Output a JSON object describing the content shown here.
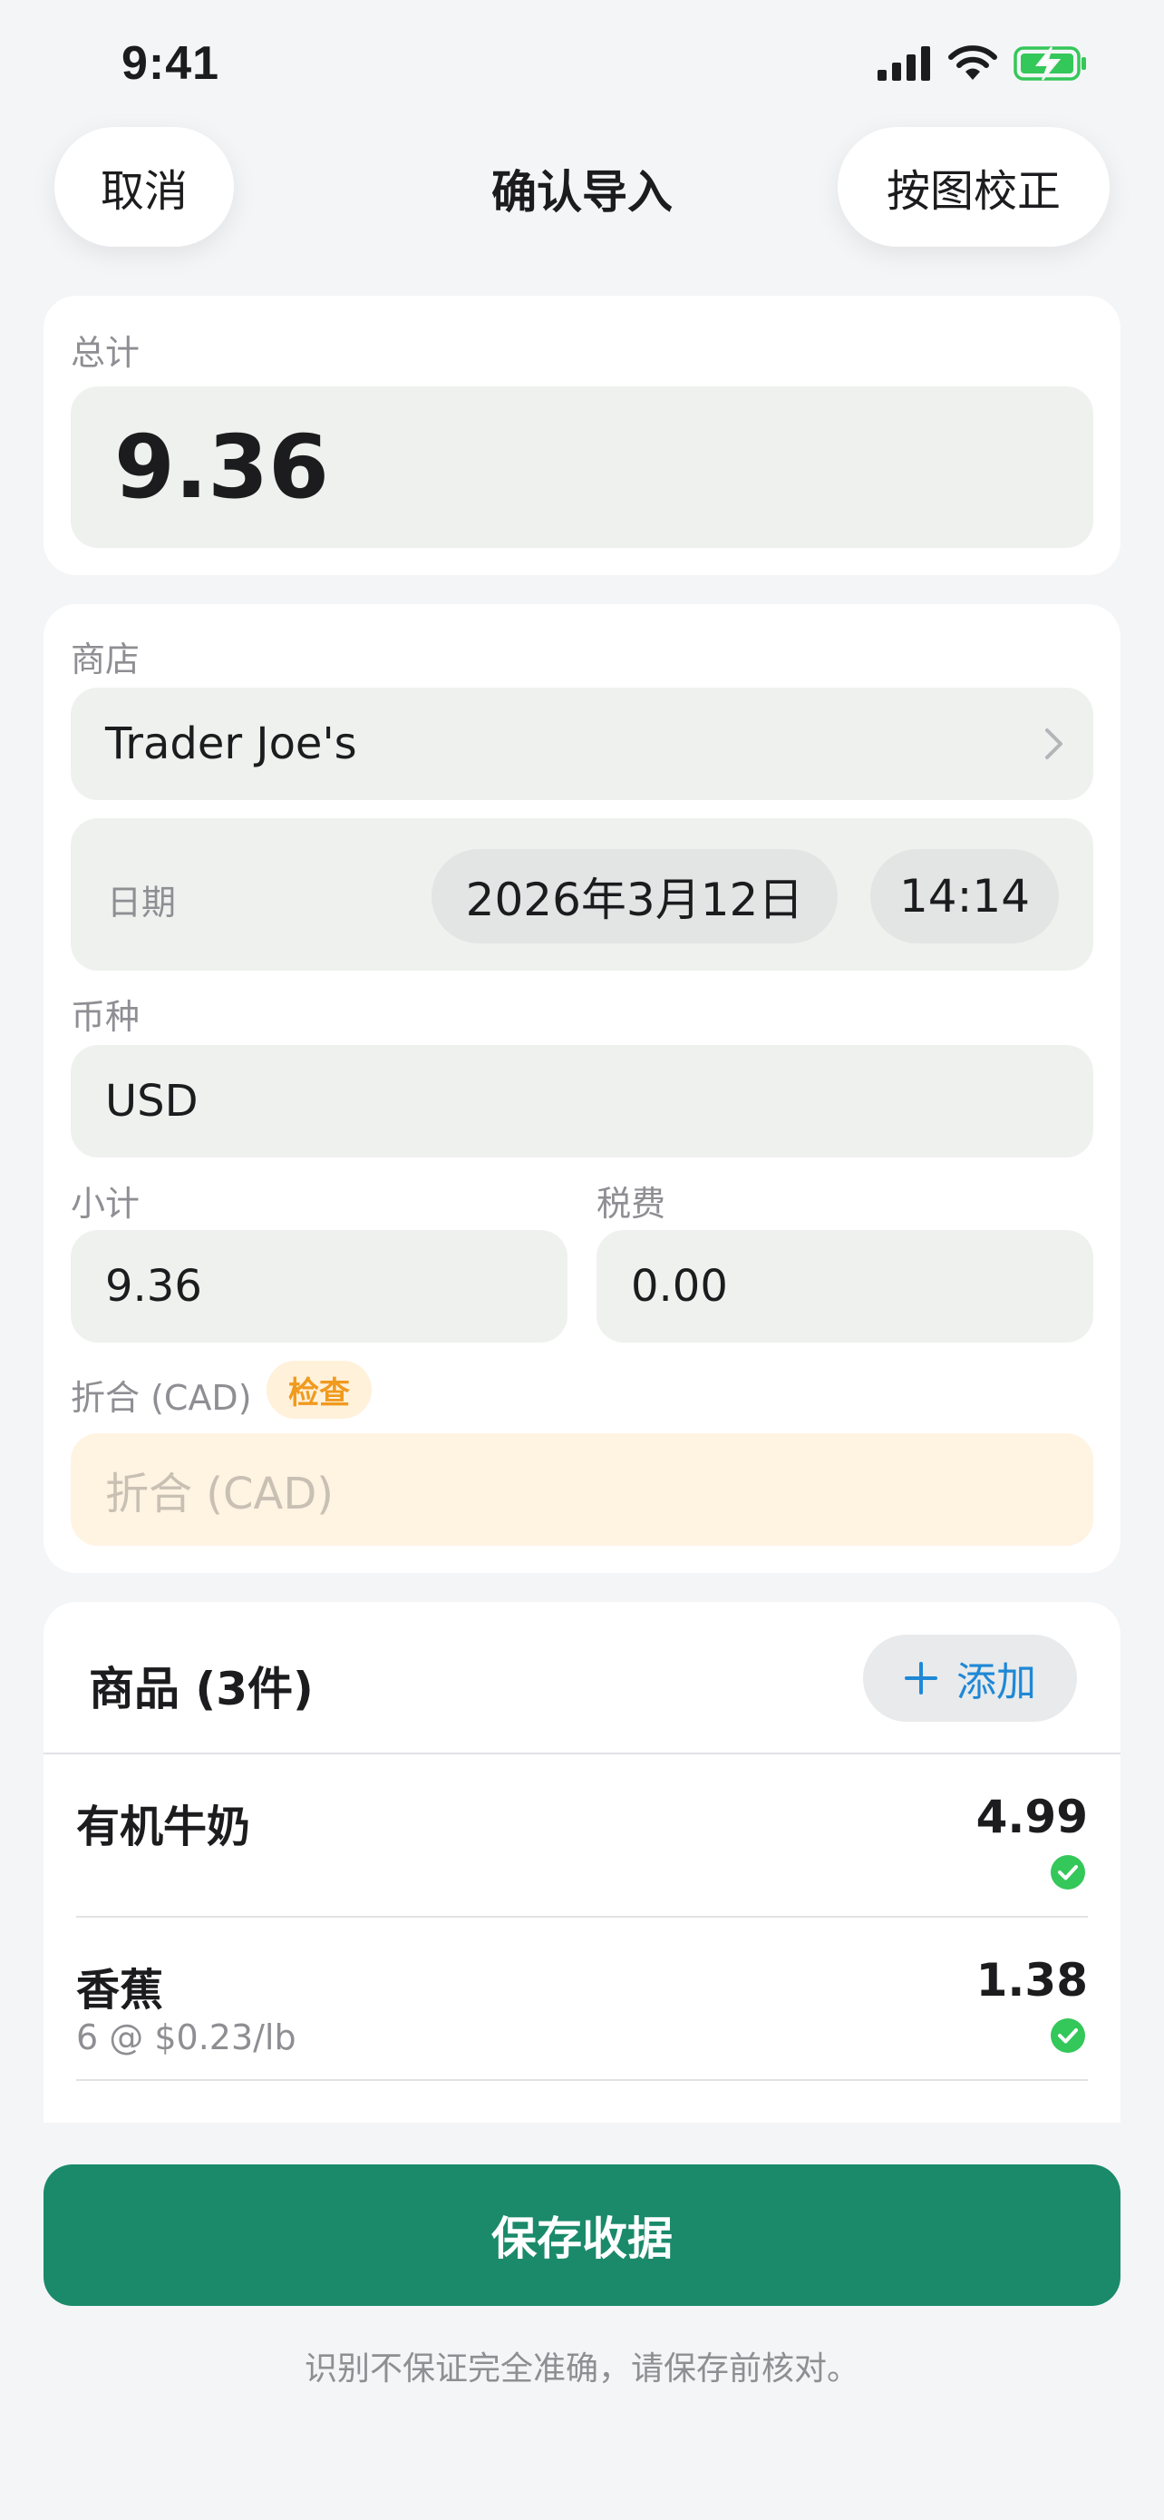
{
  "status_bar": {
    "time": "9:41"
  },
  "nav": {
    "cancel_label": "取消",
    "title": "确认导入",
    "fix_label": "按图校正"
  },
  "total": {
    "label": "总计",
    "value": "9.36"
  },
  "store": {
    "label": "商店",
    "value": "Trader Joe's"
  },
  "date": {
    "label": "日期",
    "date_value": "2026年3月12日",
    "time_value": "14:14"
  },
  "currency": {
    "label": "币种",
    "value": "USD"
  },
  "subtotal": {
    "label": "小计",
    "value": "9.36"
  },
  "tax": {
    "label": "税费",
    "value": "0.00"
  },
  "converted": {
    "label": "折合 (CAD)",
    "badge": "检查",
    "placeholder": "折合 (CAD)"
  },
  "items": {
    "title": "商品 (3件)",
    "add_label": "添加",
    "list": [
      {
        "name": "有机牛奶",
        "detail": "",
        "price": "4.99"
      },
      {
        "name": "香蕉",
        "detail": "6 @ $0.23/lb",
        "price": "1.38"
      }
    ]
  },
  "actions": {
    "save_label": "保存收据"
  },
  "footer": {
    "note": "识别不保证完全准确，请保存前核对。"
  },
  "colors": {
    "accent": "#1a8a6a",
    "link": "#1f88d6",
    "warning": "#f09a1e",
    "ok": "#34c759"
  }
}
